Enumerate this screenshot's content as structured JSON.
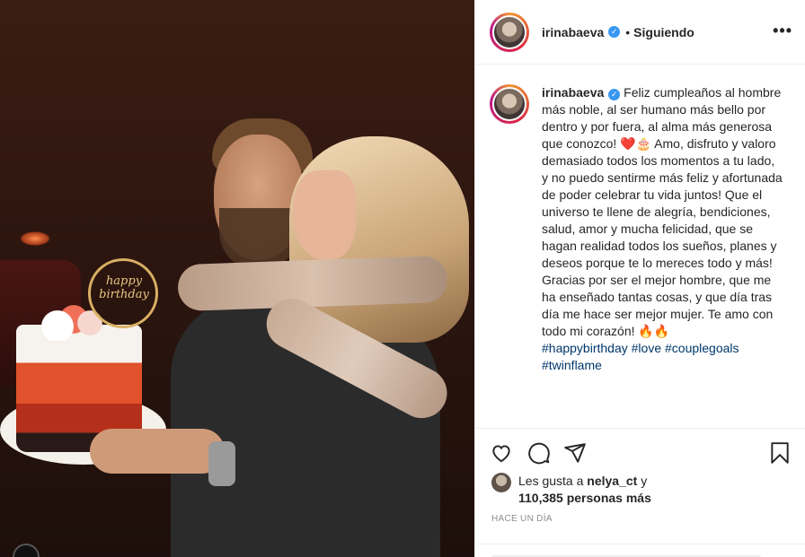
{
  "header": {
    "username": "irinabaeva",
    "separator": "•",
    "follow_status": "Siguiendo",
    "more_label": "•••"
  },
  "caption": {
    "username": "irinabaeva",
    "text": " Feliz cumpleaños al hombre más noble, al ser humano más bello por dentro y por fuera, al alma más generosa que conozco! ❤️🎂 Amo, disfruto y valoro demasiado todos los momentos a tu lado, y no puedo sentirme más feliz y afortunada de poder celebrar tu vida juntos! Que el universo te llene de alegría, bendiciones, salud, amor y mucha felicidad, que se hagan realidad todos los sueños, planes y deseos porque te lo mereces todo y más! Gracias por ser el mejor hombre, que me ha enseñado tantas cosas, y que día tras día me hace ser mejor mujer. Te amo con todo mi corazón! 🔥🔥",
    "hashtags": [
      "#happybirthday",
      "#love",
      "#couplegoals",
      "#twinflame"
    ]
  },
  "photo": {
    "topper_text": "happy birthday"
  },
  "actions": {
    "like": "heart-icon",
    "comment": "comment-icon",
    "share": "share-icon",
    "save": "bookmark-icon"
  },
  "likes": {
    "prefix": "Les gusta a ",
    "liker": "nelya_ct",
    "middle": " y ",
    "count": "110,385 personas más"
  },
  "timestamp": "HACE UN DÍA",
  "colors": {
    "verified": "#3897f0",
    "hashtag": "#00376b",
    "muted": "#8e8e8e"
  }
}
